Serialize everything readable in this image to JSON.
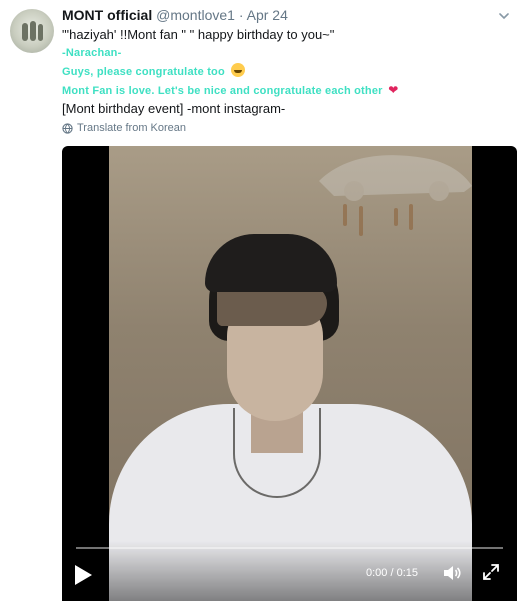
{
  "tweet": {
    "display_name": "MONT official",
    "handle": "@montlove1",
    "separator": "·",
    "date": "Apr 24",
    "lines": {
      "line1": "\"'haziyah' !!Mont fan \" \" happy birthday to you~\"",
      "line2": "-Narachan-",
      "line3": "Guys, please congratulate too",
      "line4": "Mont Fan is love. Let's be nice and congratulate each other",
      "line5": "[Mont birthday event] -mont instagram-"
    },
    "translate_label": "Translate from Korean"
  },
  "video": {
    "time_display": "0:00 / 0:15",
    "progress": 0
  },
  "colors": {
    "accent_text": "#3fe0c3",
    "heart": "#e0245e",
    "emoji": "#ffcc4d"
  },
  "icons": [
    "avatar",
    "caret-down-icon",
    "grinning-emoji-icon",
    "heart-icon",
    "globe-icon",
    "play-icon",
    "volume-icon",
    "fullscreen-icon"
  ]
}
